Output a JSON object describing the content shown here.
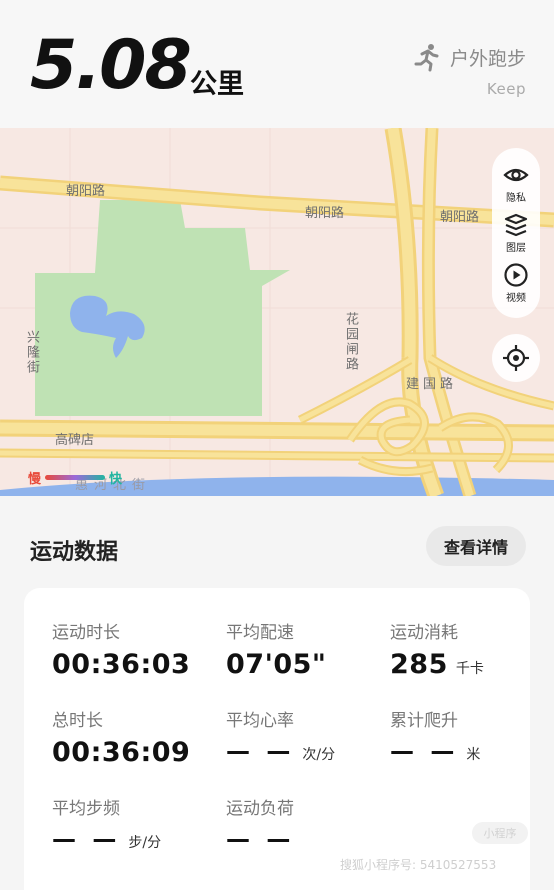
{
  "summary": {
    "distance": "5.08",
    "distance_unit": "公里",
    "activity_type": "户外跑步",
    "activity_icon": "running-figure-icon",
    "brand": "Keep"
  },
  "map": {
    "roads": {
      "chaoyang_1": "朝阳路",
      "chaoyang_2": "朝阳路",
      "chaoyang_3": "朝阳路",
      "xinglong": "兴隆街",
      "huayuan": "花园闸路",
      "jianguo": "建国路",
      "gaobeidian": "高碑店",
      "huihe": "惠河北街"
    },
    "tools": [
      {
        "label": "隐私",
        "icon": "eye-icon"
      },
      {
        "label": "图层",
        "icon": "layers-icon"
      },
      {
        "label": "视频",
        "icon": "play-icon"
      }
    ],
    "locate_icon": "crosshair-icon",
    "pace_legend": {
      "slow": "慢",
      "fast": "快"
    },
    "colors": {
      "park": "#bfe2b4",
      "water": "#8fb3ec",
      "highway": "#f7dc7d",
      "background": "#f7e8e3"
    }
  },
  "section": {
    "title": "运动数据",
    "details_button": "查看详情"
  },
  "stats": [
    {
      "label": "运动时长",
      "value": "00:36:03",
      "unit": ""
    },
    {
      "label": "平均配速",
      "value": "07'05\"",
      "unit": ""
    },
    {
      "label": "运动消耗",
      "value": "285",
      "unit": "千卡"
    },
    {
      "label": "总时长",
      "value": "00:36:09",
      "unit": ""
    },
    {
      "label": "平均心率",
      "value": "— —",
      "unit": "次/分"
    },
    {
      "label": "累计爬升",
      "value": "— —",
      "unit": "米"
    },
    {
      "label": "平均步频",
      "value": "— —",
      "unit": "步/分"
    },
    {
      "label": "运动负荷",
      "value": "— —",
      "unit": ""
    }
  ],
  "watermark": {
    "text": "搜狐小程序号: 5410527553",
    "badge": "小程序"
  }
}
